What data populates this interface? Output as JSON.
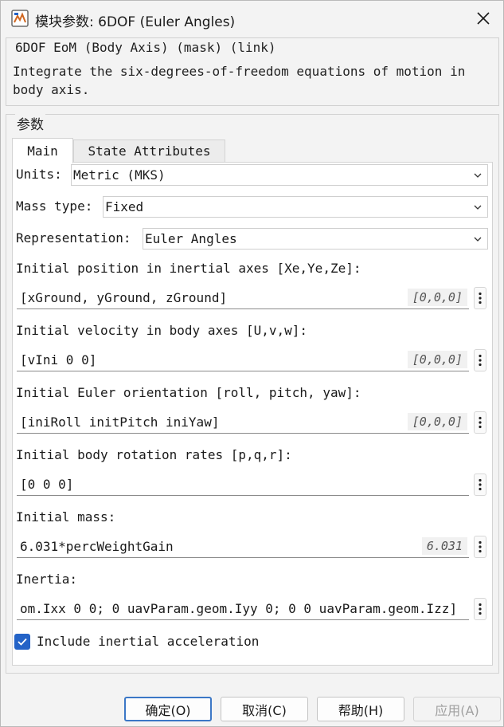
{
  "window": {
    "title": "模块参数: 6DOF (Euler Angles)"
  },
  "header": {
    "block_type": "6DOF EoM (Body Axis) (mask) (link)",
    "description": "Integrate the six-degrees-of-freedom equations of motion in body axis."
  },
  "params": {
    "group_title": "参数",
    "tabs": [
      {
        "label": "Main",
        "active": true
      },
      {
        "label": "State Attributes",
        "active": false
      }
    ],
    "units": {
      "label": "Units:",
      "value": "Metric (MKS)"
    },
    "mass_type": {
      "label": "Mass type:",
      "value": "Fixed"
    },
    "representation": {
      "label": "Representation:",
      "value": "Euler Angles"
    },
    "init_position": {
      "label": "Initial position in inertial axes [Xe,Ye,Ze]:",
      "value": "[xGround, yGround, zGround]",
      "hint": "[0,0,0]"
    },
    "init_velocity": {
      "label": "Initial velocity in body axes [U,v,w]:",
      "value": "[vIni 0 0]",
      "hint": "[0,0,0]"
    },
    "init_euler": {
      "label": "Initial Euler orientation [roll, pitch, yaw]:",
      "value": "[iniRoll initPitch iniYaw]",
      "hint": "[0,0,0]"
    },
    "init_rates": {
      "label": "Initial body rotation rates [p,q,r]:",
      "value": "[0 0 0]"
    },
    "init_mass": {
      "label": "Initial mass:",
      "value": "6.031*percWeightGain",
      "hint": "6.031"
    },
    "inertia": {
      "label": "Inertia:",
      "value": "om.Ixx 0 0; 0 uavParam.geom.Iyy 0; 0 0 uavParam.geom.Izz]"
    },
    "include_accel": {
      "label": "Include inertial acceleration",
      "checked": true
    }
  },
  "buttons": {
    "ok": "确定(O)",
    "cancel": "取消(C)",
    "help": "帮助(H)",
    "apply": "应用(A)"
  },
  "colors": {
    "accent": "#2463c7",
    "primary_border": "#3b77c6"
  },
  "icons": {
    "app": "simulink-block-icon",
    "close": "close-icon",
    "dropdown": "chevron-down-icon",
    "more": "more-vertical-icon",
    "check": "checkmark-icon"
  }
}
